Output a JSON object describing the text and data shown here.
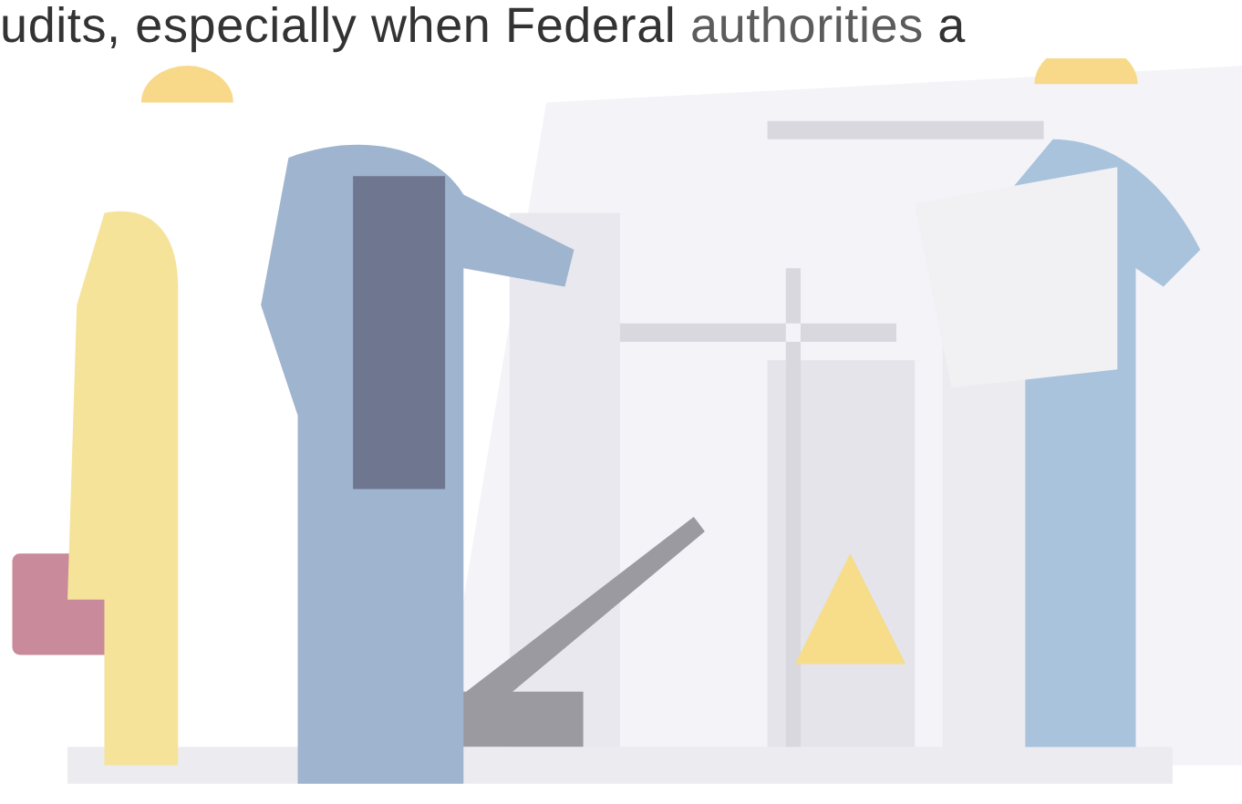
{
  "paragraph": {
    "text_before": "udits, especially when Federal ",
    "link": "authorities",
    "text_after": " a"
  }
}
